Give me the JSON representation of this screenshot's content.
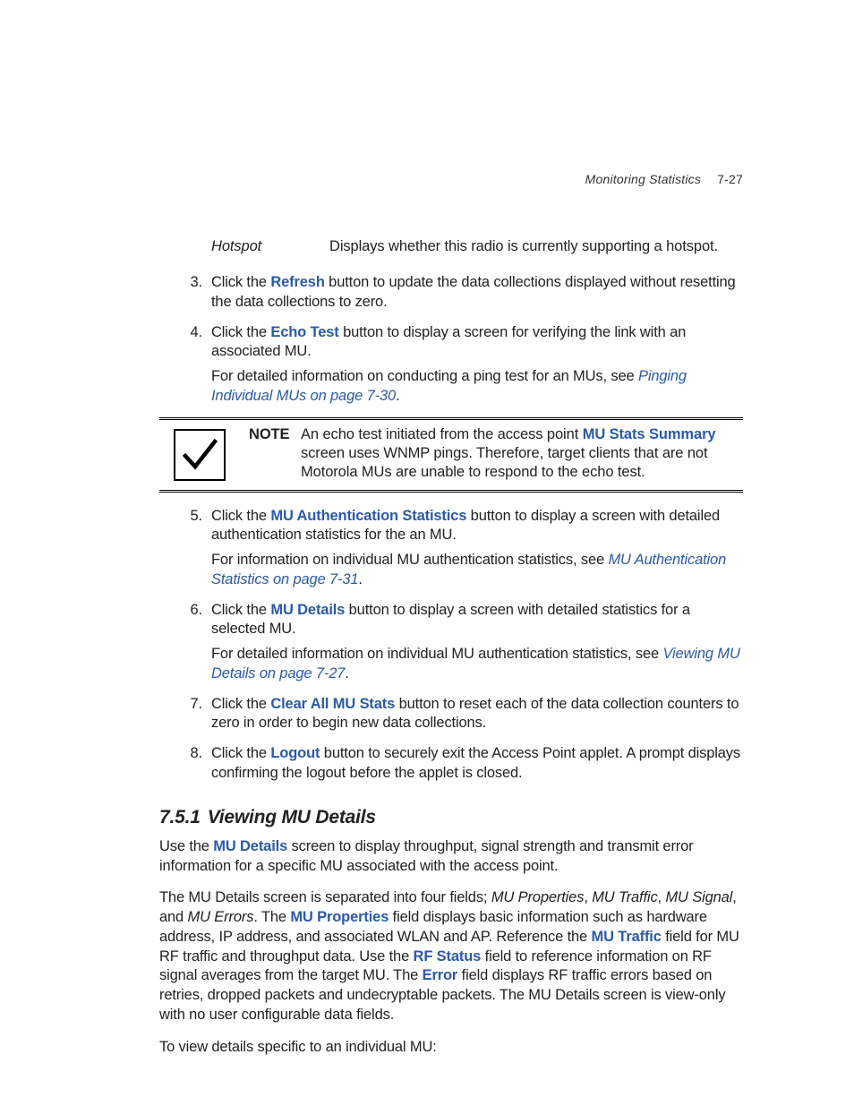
{
  "header": {
    "title": "Monitoring Statistics",
    "page": "7-27"
  },
  "kv": {
    "key": "Hotspot",
    "val": "Displays whether this radio is currently supporting a hotspot."
  },
  "steps": {
    "s3": {
      "num": "3.",
      "pre": "Click the ",
      "bold": "Refresh",
      "post": " button to update the data collections displayed without resetting the data collections to zero."
    },
    "s4": {
      "num": "4.",
      "p1_pre": "Click the ",
      "p1_bold": "Echo Test",
      "p1_post": " button to display a screen for verifying the link with an associated MU.",
      "p2_pre": "For detailed information on conducting a ping test for an MUs, see ",
      "p2_link": "Pinging Individual MUs on page 7-30",
      "p2_post": "."
    },
    "s5": {
      "num": "5.",
      "p1_pre": "Click the ",
      "p1_bold": "MU Authentication Statistics",
      "p1_post": " button to display a screen with detailed authentication statistics for the an MU.",
      "p2_pre": "For information on individual MU authentication statistics, see ",
      "p2_link": "MU Authentication Statistics on page 7-31",
      "p2_post": "."
    },
    "s6": {
      "num": "6.",
      "p1_pre": "Click the ",
      "p1_bold": "MU Details",
      "p1_post": " button to display a screen with detailed statistics for a selected MU.",
      "p2_pre": "For detailed information on individual MU authentication statistics, see ",
      "p2_link": "Viewing MU Details on page 7-27",
      "p2_post": "."
    },
    "s7": {
      "num": "7.",
      "pre": "Click the ",
      "bold": "Clear All MU Stats",
      "post": " button to reset each of the data collection counters to zero in order to begin new data collections."
    },
    "s8": {
      "num": "8.",
      "pre": "Click the ",
      "bold": "Logout",
      "post": " button to securely exit the Access Point applet. A prompt displays confirming the logout before the applet is closed."
    }
  },
  "note": {
    "label": "NOTE",
    "t1": "An echo test initiated from the access point ",
    "bold": "MU Stats Summary",
    "t2": " screen uses WNMP pings. Therefore, target clients that are not Motorola MUs are unable to respond to the echo test."
  },
  "section": {
    "num": "7.5.1",
    "title": "Viewing MU Details"
  },
  "para1": {
    "a": "Use the ",
    "b": "MU Details",
    "c": " screen to display throughput, signal strength and transmit error information for a specific MU associated with the access point."
  },
  "para2": {
    "a": "The MU Details screen is separated into four fields; ",
    "i1": "MU Properties",
    "comma1": ", ",
    "i2": "MU Traffic",
    "comma2": ", ",
    "i3": "MU Signal",
    "and": ", and ",
    "i4": "MU Errors",
    "b": ". The ",
    "bold1": "MU Properties",
    "c": " field displays basic information such as hardware address, IP address, and associated WLAN and AP. Reference the ",
    "bold2": "MU Traffic",
    "d": " field for MU RF traffic and throughput data. Use the ",
    "bold3": "RF Status",
    "e": " field to reference information on RF signal averages from the target MU. The ",
    "bold4": "Error",
    "f": " field displays RF traffic errors based on retries, dropped packets and undecryptable packets. The MU Details screen is view-only with no user configurable data fields."
  },
  "para3": "To view details specific to an individual MU:"
}
